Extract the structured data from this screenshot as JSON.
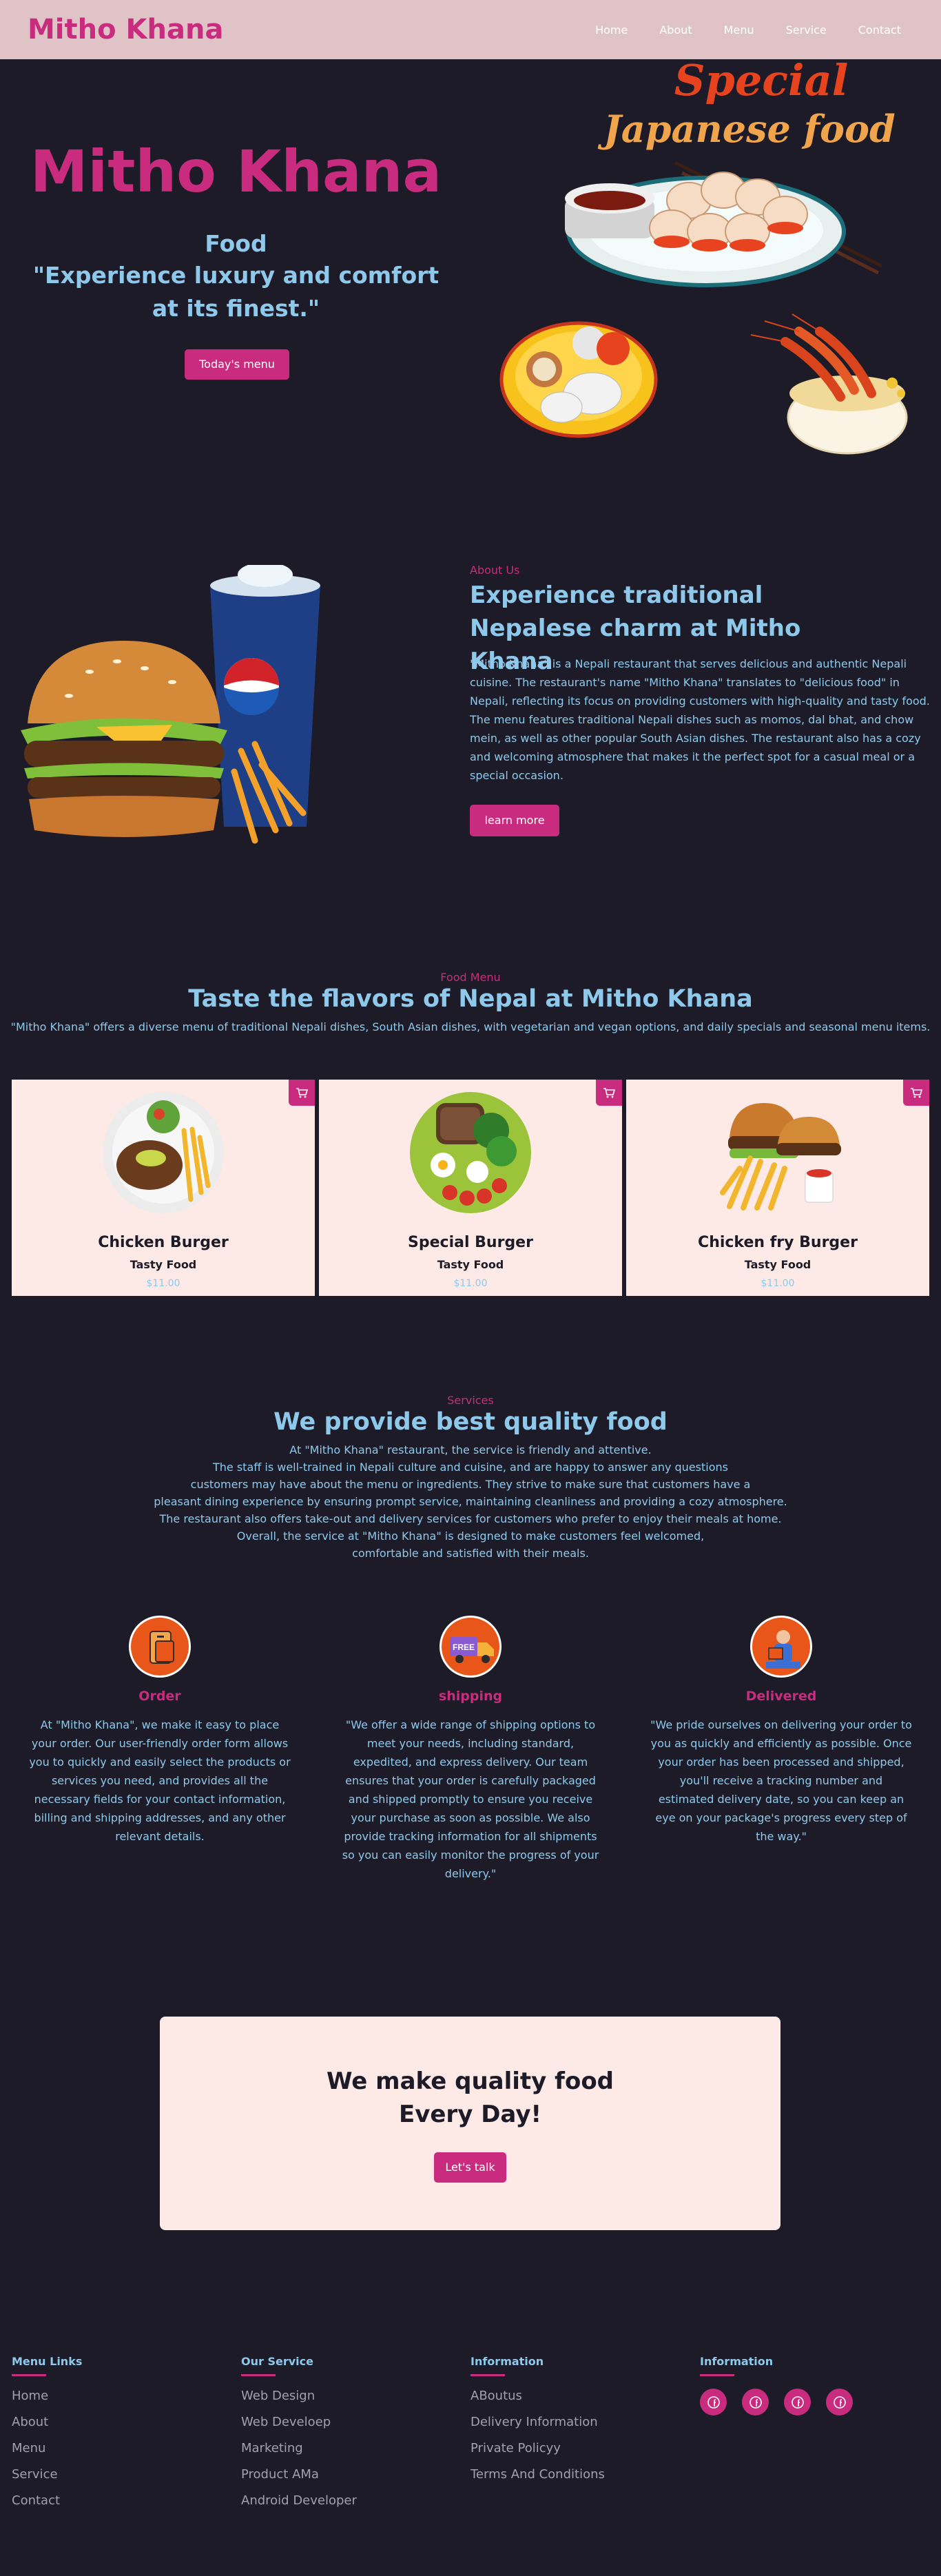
{
  "nav": {
    "brand": "Mitho Khana",
    "links": [
      "Home",
      "About",
      "Menu",
      "Service",
      "Contact"
    ]
  },
  "hero": {
    "title": "Mitho Khana",
    "subtitle": "Food",
    "quote": "\"Experience luxury and comfort at its finest.\"",
    "button": "Today's menu",
    "art_line1": "Special",
    "art_line2": "Japanese food"
  },
  "about": {
    "kicker": "About Us",
    "title": "Experience traditional Nepalese charm at Mitho Khana",
    "text": "\"Mitho Khana\" is a Nepali restaurant that serves delicious and authentic Nepali cuisine. The restaurant's name \"Mitho Khana\" translates to \"delicious food\" in Nepali, reflecting its focus on providing customers with high-quality and tasty food. The menu features traditional Nepali dishes such as momos, dal bhat, and chow mein, as well as other popular South Asian dishes. The restaurant also has a cozy and welcoming atmosphere that makes it the perfect spot for a casual meal or a special occasion.",
    "button": "learn more"
  },
  "menu": {
    "kicker": "Food Menu",
    "title": "Taste the flavors of Nepal at Mitho Khana",
    "desc": "\"Mitho Khana\" offers a diverse menu of traditional Nepali dishes, South Asian dishes, with vegetarian and vegan options, and daily specials and seasonal menu items.",
    "items": [
      {
        "name": "Chicken Burger",
        "sub": "Tasty Food",
        "price": "$11.00"
      },
      {
        "name": "Special Burger",
        "sub": "Tasty Food",
        "price": "$11.00"
      },
      {
        "name": "Chicken fry Burger",
        "sub": "Tasty Food",
        "price": "$11.00"
      }
    ]
  },
  "services": {
    "kicker": "Services",
    "title": "We provide best quality food",
    "lines": [
      "At \"Mitho Khana\" restaurant, the service is friendly and attentive.",
      "The staff is well-trained in Nepali culture and cuisine, and are happy to answer any questions",
      "customers may have about the menu or ingredients. They strive to make sure that customers have a",
      "pleasant dining experience by ensuring prompt service, maintaining cleanliness and providing a cozy atmosphere.",
      "The restaurant also offers take-out and delivery services for customers who prefer to enjoy their meals at home.",
      "Overall, the service at \"Mitho Khana\" is designed to make customers feel welcomed,",
      "comfortable and satisfied with their meals."
    ],
    "items": [
      {
        "name": "Order",
        "desc": "At \"Mitho Khana\", we make it easy to place your order. Our user-friendly order form allows you to quickly and easily select the products or services you need, and provides all the necessary fields for your contact information, billing and shipping addresses, and any other relevant details."
      },
      {
        "name": "shipping",
        "desc": "\"We offer a wide range of shipping options to meet your needs, including standard, expedited, and express delivery. Our team ensures that your order is carefully packaged and shipped promptly to ensure you receive your purchase as soon as possible. We also provide tracking information for all shipments so you can easily monitor the progress of your delivery.\"",
        "badge": "FREE"
      },
      {
        "name": "Delivered",
        "desc": "\"We pride ourselves on delivering your order to you as quickly and efficiently as possible. Once your order has been processed and shipped, you'll receive a tracking number and estimated delivery date, so you can keep an eye on your package's progress every step of the way.\""
      }
    ]
  },
  "cta": {
    "line1": "We make quality food",
    "line2": "Every Day!",
    "button": "Let's talk"
  },
  "footer": {
    "cols": [
      {
        "title": "Menu Links",
        "items": [
          "Home",
          "About",
          "Menu",
          "Service",
          "Contact"
        ]
      },
      {
        "title": "Our Service",
        "items": [
          "Web Design",
          "Web Develoep",
          "Marketing",
          "Product AMa",
          "Android Developer"
        ]
      },
      {
        "title": "Information",
        "items": [
          "ABoutus",
          "Delivery Information",
          "Private Policyy",
          "Terms And Conditions"
        ]
      },
      {
        "title": "Information",
        "socials": [
          "facebook-icon",
          "facebook-icon",
          "facebook-icon",
          "facebook-icon"
        ]
      }
    ]
  },
  "colors": {
    "brand": "#c92c7e",
    "accent": "#8ec9ec",
    "background": "#1d1b27",
    "navbar": "#dfc3c6",
    "card": "#fdeae6"
  }
}
